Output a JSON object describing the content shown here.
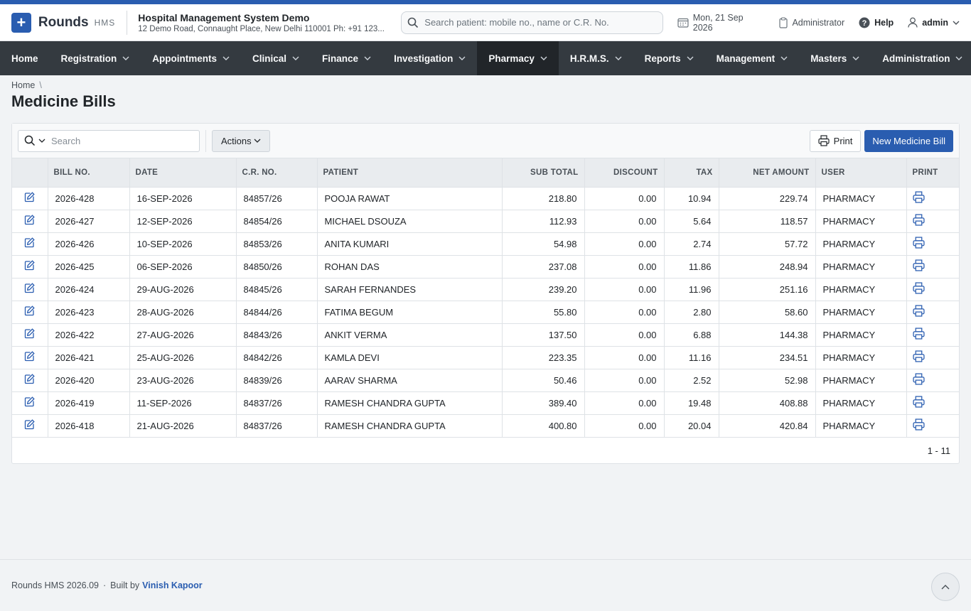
{
  "header": {
    "brand": "Rounds",
    "brand_sub": "HMS",
    "org_name": "Hospital Management System Demo",
    "org_address": "12 Demo Road, Connaught Place, New Delhi 110001 Ph: +91 123...",
    "search_placeholder": "Search patient: mobile no., name or C.R. No.",
    "date": "Mon, 21 Sep 2026",
    "role": "Administrator",
    "help": "Help",
    "user": "admin"
  },
  "nav": [
    {
      "label": "Home",
      "chevron": false,
      "active": false
    },
    {
      "label": "Registration",
      "chevron": true,
      "active": false
    },
    {
      "label": "Appointments",
      "chevron": true,
      "active": false
    },
    {
      "label": "Clinical",
      "chevron": true,
      "active": false
    },
    {
      "label": "Finance",
      "chevron": true,
      "active": false
    },
    {
      "label": "Investigation",
      "chevron": true,
      "active": false
    },
    {
      "label": "Pharmacy",
      "chevron": true,
      "active": true
    },
    {
      "label": "H.R.M.S.",
      "chevron": true,
      "active": false
    },
    {
      "label": "Reports",
      "chevron": true,
      "active": false
    },
    {
      "label": "Management",
      "chevron": true,
      "active": false
    },
    {
      "label": "Masters",
      "chevron": true,
      "active": false
    },
    {
      "label": "Administration",
      "chevron": true,
      "active": false
    }
  ],
  "breadcrumb": {
    "home": "Home",
    "separator": "\\"
  },
  "page_title": "Medicine Bills",
  "toolbar": {
    "search_placeholder": "Search",
    "actions_label": "Actions",
    "print_label": "Print",
    "new_label": "New Medicine Bill"
  },
  "table": {
    "columns": [
      "",
      "BILL NO.",
      "DATE",
      "C.R. NO.",
      "PATIENT",
      "SUB TOTAL",
      "DISCOUNT",
      "TAX",
      "NET AMOUNT",
      "USER",
      "PRINT"
    ],
    "rows": [
      {
        "bill_no": "2026-428",
        "date": "16-SEP-2026",
        "cr_no": "84857/26",
        "patient": "POOJA RAWAT",
        "sub_total": "218.80",
        "discount": "0.00",
        "tax": "10.94",
        "net_amount": "229.74",
        "user": "PHARMACY"
      },
      {
        "bill_no": "2026-427",
        "date": "12-SEP-2026",
        "cr_no": "84854/26",
        "patient": "MICHAEL DSOUZA",
        "sub_total": "112.93",
        "discount": "0.00",
        "tax": "5.64",
        "net_amount": "118.57",
        "user": "PHARMACY"
      },
      {
        "bill_no": "2026-426",
        "date": "10-SEP-2026",
        "cr_no": "84853/26",
        "patient": "ANITA KUMARI",
        "sub_total": "54.98",
        "discount": "0.00",
        "tax": "2.74",
        "net_amount": "57.72",
        "user": "PHARMACY"
      },
      {
        "bill_no": "2026-425",
        "date": "06-SEP-2026",
        "cr_no": "84850/26",
        "patient": "ROHAN DAS",
        "sub_total": "237.08",
        "discount": "0.00",
        "tax": "11.86",
        "net_amount": "248.94",
        "user": "PHARMACY"
      },
      {
        "bill_no": "2026-424",
        "date": "29-AUG-2026",
        "cr_no": "84845/26",
        "patient": "SARAH FERNANDES",
        "sub_total": "239.20",
        "discount": "0.00",
        "tax": "11.96",
        "net_amount": "251.16",
        "user": "PHARMACY"
      },
      {
        "bill_no": "2026-423",
        "date": "28-AUG-2026",
        "cr_no": "84844/26",
        "patient": "FATIMA BEGUM",
        "sub_total": "55.80",
        "discount": "0.00",
        "tax": "2.80",
        "net_amount": "58.60",
        "user": "PHARMACY"
      },
      {
        "bill_no": "2026-422",
        "date": "27-AUG-2026",
        "cr_no": "84843/26",
        "patient": "ANKIT VERMA",
        "sub_total": "137.50",
        "discount": "0.00",
        "tax": "6.88",
        "net_amount": "144.38",
        "user": "PHARMACY"
      },
      {
        "bill_no": "2026-421",
        "date": "25-AUG-2026",
        "cr_no": "84842/26",
        "patient": "KAMLA DEVI",
        "sub_total": "223.35",
        "discount": "0.00",
        "tax": "11.16",
        "net_amount": "234.51",
        "user": "PHARMACY"
      },
      {
        "bill_no": "2026-420",
        "date": "23-AUG-2026",
        "cr_no": "84839/26",
        "patient": "AARAV SHARMA",
        "sub_total": "50.46",
        "discount": "0.00",
        "tax": "2.52",
        "net_amount": "52.98",
        "user": "PHARMACY"
      },
      {
        "bill_no": "2026-419",
        "date": "11-SEP-2026",
        "cr_no": "84837/26",
        "patient": "RAMESH CHANDRA GUPTA",
        "sub_total": "389.40",
        "discount": "0.00",
        "tax": "19.48",
        "net_amount": "408.88",
        "user": "PHARMACY"
      },
      {
        "bill_no": "2026-418",
        "date": "21-AUG-2026",
        "cr_no": "84837/26",
        "patient": "RAMESH CHANDRA GUPTA",
        "sub_total": "400.80",
        "discount": "0.00",
        "tax": "20.04",
        "net_amount": "420.84",
        "user": "PHARMACY"
      }
    ]
  },
  "pager": "1 - 11",
  "footer": {
    "version": "Rounds HMS 2026.09",
    "separator": "·",
    "built_by": "Built by",
    "author": "Vinish Kapoor"
  },
  "icons": {
    "edit": "edit-icon",
    "print": "printer-icon",
    "search": "search-icon",
    "calendar": "calendar-icon",
    "role": "clipboard-icon",
    "help": "help-icon",
    "user": "user-icon",
    "to_top": "chevron-up-icon"
  },
  "colors": {
    "primary": "#2a5db0",
    "nav_bg": "#343a40",
    "nav_active": "#212529"
  }
}
